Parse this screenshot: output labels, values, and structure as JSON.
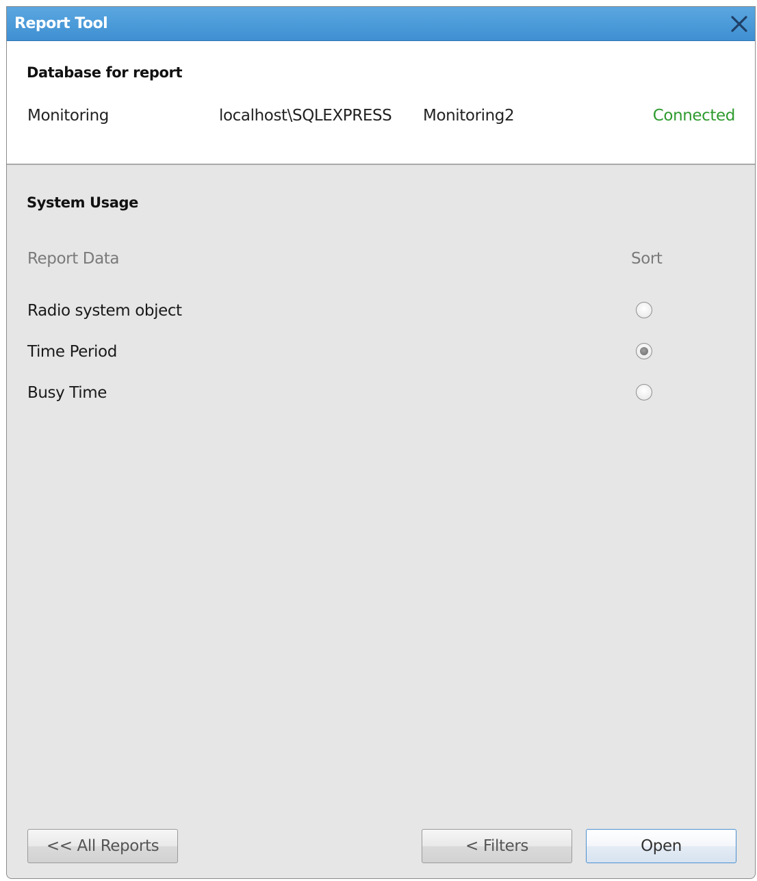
{
  "window": {
    "title": "Report Tool"
  },
  "database": {
    "heading": "Database for report",
    "name": "Monitoring",
    "server": "localhost\\SQLEXPRESS",
    "catalog": "Monitoring2",
    "status": "Connected",
    "status_color": "#2e9b2e"
  },
  "report": {
    "heading": "System Usage",
    "columns": {
      "data": "Report Data",
      "sort": "Sort"
    },
    "rows": [
      {
        "label": "Radio system object",
        "sort_selected": false
      },
      {
        "label": "Time Period",
        "sort_selected": true
      },
      {
        "label": "Busy Time",
        "sort_selected": false
      }
    ]
  },
  "buttons": {
    "all_reports": "<< All Reports",
    "filters": "< Filters",
    "open": "Open"
  },
  "colors": {
    "titlebar": "#4a9ad8",
    "accent": "#4b8fd0"
  },
  "icons": {
    "close": "close-icon"
  }
}
